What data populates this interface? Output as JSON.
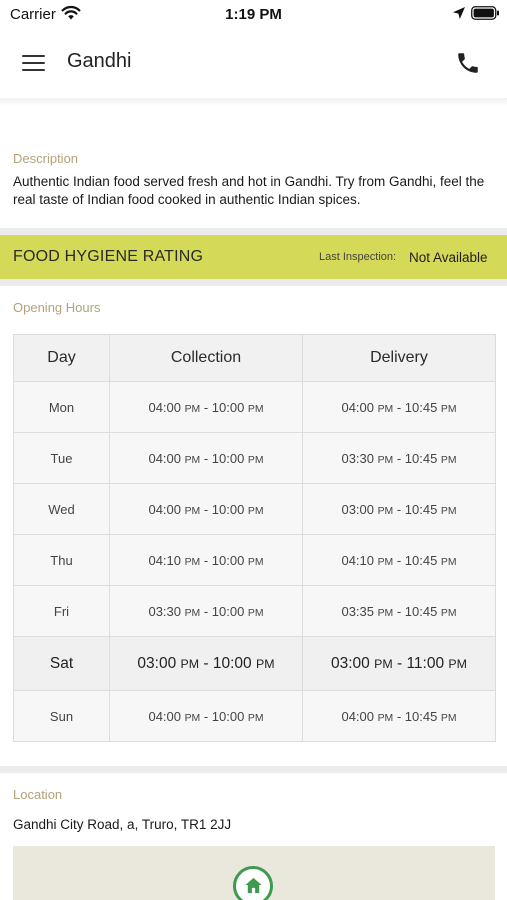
{
  "status_bar": {
    "carrier": "Carrier",
    "time": "1:19 PM"
  },
  "nav": {
    "title": "Gandhi",
    "menu_icon": "hamburger-menu-icon",
    "call_icon": "phone-icon"
  },
  "description": {
    "label": "Description",
    "text": "Authentic Indian food served fresh and hot in Gandhi. Try from Gandhi, feel the real taste of Indian food cooked in authentic Indian spices."
  },
  "hygiene": {
    "title": "FOOD HYGIENE RATING",
    "last_inspection_label": "Last Inspection:",
    "last_inspection_value": "Not Available",
    "bar_color": "#d4da57"
  },
  "opening_hours": {
    "label": "Opening Hours",
    "headers": [
      "Day",
      "Collection",
      "Delivery"
    ],
    "rows": [
      {
        "day": "Mon",
        "collection": "04:00 PM - 10:00 PM",
        "delivery": "04:00 PM - 10:45 PM"
      },
      {
        "day": "Tue",
        "collection": "04:00 PM - 10:00 PM",
        "delivery": "03:30 PM - 10:45 PM"
      },
      {
        "day": "Wed",
        "collection": "04:00 PM - 10:00 PM",
        "delivery": "03:00 PM - 10:45 PM"
      },
      {
        "day": "Thu",
        "collection": "04:10 PM - 10:00 PM",
        "delivery": "04:10 PM - 10:45 PM"
      },
      {
        "day": "Fri",
        "collection": "03:30 PM - 10:00 PM",
        "delivery": "03:35 PM - 10:45 PM"
      },
      {
        "day": "Sat",
        "collection": "03:00 PM - 10:00 PM",
        "delivery": "03:00 PM - 11:00 PM",
        "current": true
      },
      {
        "day": "Sun",
        "collection": "04:00 PM - 10:00 PM",
        "delivery": "04:00 PM - 10:45 PM"
      }
    ]
  },
  "location": {
    "label": "Location",
    "address": "Gandhi City Road, a, Truro, TR1 2JJ",
    "map_pin_icon": "home-icon",
    "pin_color": "#3d9a4e"
  },
  "colors": {
    "section_label": "#b3a27a",
    "table_border": "#dcdcdc"
  }
}
